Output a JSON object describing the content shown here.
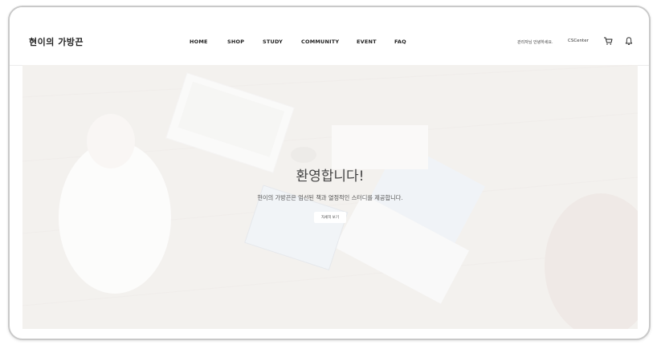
{
  "header": {
    "logo": "현이의 가방끈",
    "nav": [
      {
        "label": "HOME"
      },
      {
        "label": "SHOP"
      },
      {
        "label": "STUDY"
      },
      {
        "label": "COMMUNITY"
      },
      {
        "label": "EVENT"
      },
      {
        "label": "FAQ"
      }
    ],
    "greeting": "관리자님 안녕하세요.",
    "cs_center": "CSCenter",
    "icons": [
      "cart-icon",
      "bell-icon"
    ]
  },
  "hero": {
    "title": "환영합니다!",
    "subtitle": "현이의 가방끈은 엄선된 책과 열정적인 스터디를 제공합니다.",
    "button_label": "자세히 보기"
  },
  "colors": {
    "text": "#222222",
    "overlay": "#ffffff",
    "frame_border": "#c9c9c9"
  }
}
